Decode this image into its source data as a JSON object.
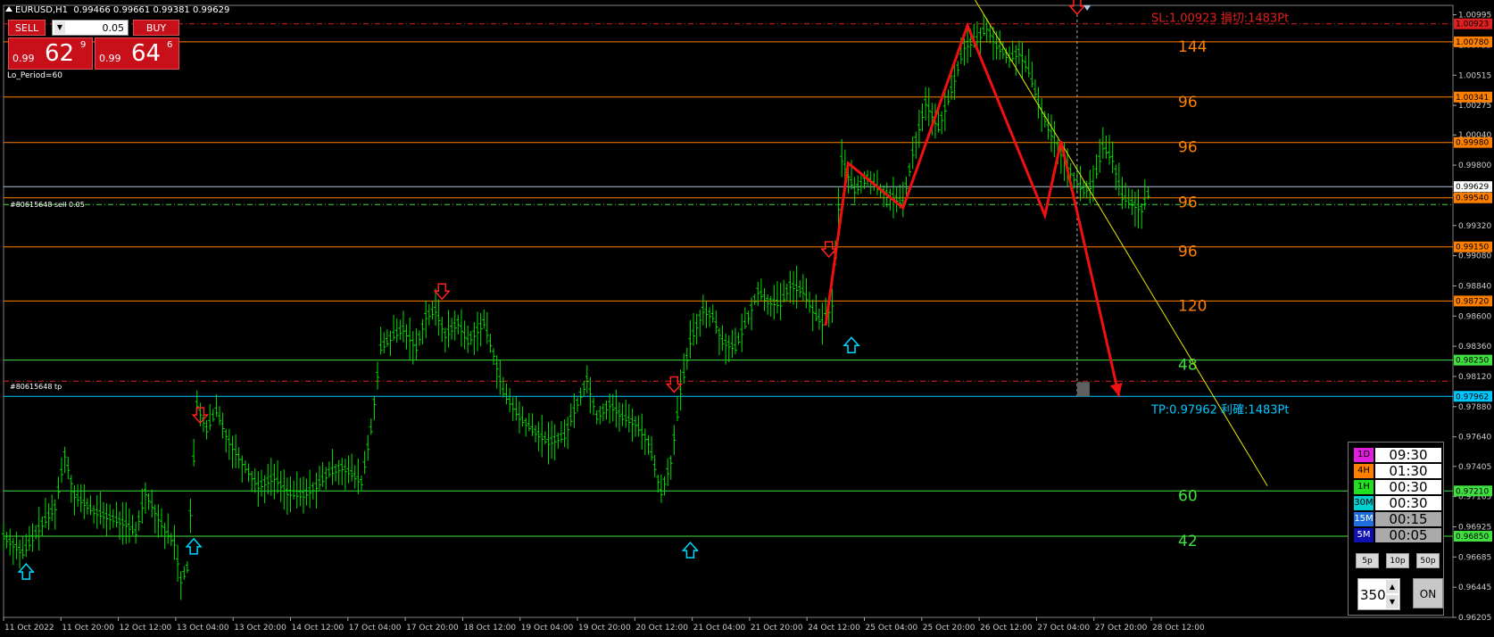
{
  "header": {
    "title": "EURUSD,H1",
    "ohlc": "0.99466 0.99661 0.99381 0.99629"
  },
  "trade_panel": {
    "sell_label": "SELL",
    "buy_label": "BUY",
    "lot": "0.05",
    "lot_arrow": "▼",
    "sell_small": "0.99",
    "sell_big": "62",
    "sell_sup": "9",
    "buy_small": "0.99",
    "buy_big": "64",
    "buy_sup": "6"
  },
  "indicator_label": "Lo_Period=60",
  "order_labels": {
    "sell": "#80615648 sell 0.05",
    "tp": "#80615648 tp"
  },
  "annotations": {
    "sl": "SL:1.00923 損切:1483Pt",
    "tp": "TP:0.97962 利確:1483Pt"
  },
  "timer_panel": {
    "rows": [
      {
        "tf": "1D",
        "time": "09:30",
        "color": "#e020e0"
      },
      {
        "tf": "4H",
        "time": "01:30",
        "color": "#ff7f00"
      },
      {
        "tf": "1H",
        "time": "00:30",
        "color": "#20e020"
      },
      {
        "tf": "30M",
        "time": "00:30",
        "color": "#00d0d0"
      },
      {
        "tf": "15M",
        "time": "00:15",
        "color": "#1e6ee0"
      },
      {
        "tf": "5M",
        "time": "00:05",
        "color": "#1010b0"
      }
    ],
    "buttons": [
      "5p",
      "10p",
      "50p"
    ],
    "spinner_value": "350",
    "spin_up": "▲",
    "spin_down": "▼",
    "on_label": "ON"
  },
  "chart_data": {
    "type": "line",
    "symbol": "EURUSD",
    "timeframe": "H1",
    "price_axis_ticks": [
      "1.00995",
      "1.00755",
      "1.00515",
      "1.00275",
      "1.00040",
      "0.99800",
      "0.99560",
      "0.99320",
      "0.99080",
      "0.98840",
      "0.98600",
      "0.98360",
      "0.98120",
      "0.97880",
      "0.97640",
      "0.97405",
      "0.97165",
      "0.96925",
      "0.96685",
      "0.96445",
      "0.96205"
    ],
    "time_axis_labels": [
      "11 Oct 2022",
      "11 Oct 20:00",
      "12 Oct 12:00",
      "13 Oct 04:00",
      "13 Oct 20:00",
      "14 Oct 12:00",
      "17 Oct 04:00",
      "17 Oct 20:00",
      "18 Oct 12:00",
      "19 Oct 04:00",
      "19 Oct 20:00",
      "20 Oct 12:00",
      "21 Oct 04:00",
      "21 Oct 20:00",
      "24 Oct 12:00",
      "25 Oct 04:00",
      "25 Oct 20:00",
      "26 Oct 12:00",
      "27 Oct 04:00",
      "27 Oct 20:00",
      "28 Oct 12:00"
    ],
    "ylim": [
      0.96205,
      1.0107
    ],
    "horizontal_levels": [
      {
        "price": 1.00923,
        "label": "1.00923",
        "color": "#e02020",
        "style": "dashdot"
      },
      {
        "price": 1.0078,
        "label": "1.00780",
        "color": "#ff7f00"
      },
      {
        "price": 1.00341,
        "label": "1.00341",
        "color": "#ff7f00"
      },
      {
        "price": 0.9998,
        "label": "0.99980",
        "color": "#ff7f00"
      },
      {
        "price": 0.99629,
        "label": "0.99629",
        "color": "#b0c4de",
        "style": "bid"
      },
      {
        "price": 0.9954,
        "label": "0.99540",
        "color": "#ff7f00"
      },
      {
        "price": 0.9915,
        "label": "0.99150",
        "color": "#ff7f00"
      },
      {
        "price": 0.9872,
        "label": "0.98720",
        "color": "#ff7f00"
      },
      {
        "price": 0.9825,
        "label": "0.98250",
        "color": "#40e040"
      },
      {
        "price": 0.97962,
        "label": "0.97962",
        "color": "#00c8ff",
        "style": "tp"
      },
      {
        "price": 0.9721,
        "label": "0.97210",
        "color": "#40e040"
      },
      {
        "price": 0.9685,
        "label": "0.96850",
        "color": "#40e040"
      }
    ],
    "level_counts": [
      {
        "price": 1.0078,
        "text": "144",
        "color": "#ff7f00"
      },
      {
        "price": 1.00341,
        "text": "96",
        "color": "#ff7f00"
      },
      {
        "price": 0.9998,
        "text": "96",
        "color": "#ff7f00"
      },
      {
        "price": 0.9954,
        "text": "96",
        "color": "#ff7f00"
      },
      {
        "price": 0.9915,
        "text": "96",
        "color": "#ff7f00"
      },
      {
        "price": 0.9872,
        "text": "120",
        "color": "#ff7f00"
      },
      {
        "price": 0.9825,
        "text": "48",
        "color": "#40e040"
      },
      {
        "price": 0.9721,
        "text": "60",
        "color": "#40e040"
      },
      {
        "price": 0.9685,
        "text": "42",
        "color": "#40e040"
      }
    ],
    "price_path": [
      [
        0,
        0.9685
      ],
      [
        6,
        0.9672
      ],
      [
        12,
        0.9695
      ],
      [
        16,
        0.9708
      ],
      [
        19,
        0.975
      ],
      [
        22,
        0.9718
      ],
      [
        28,
        0.9705
      ],
      [
        33,
        0.97
      ],
      [
        38,
        0.9695
      ],
      [
        41,
        0.9688
      ],
      [
        44,
        0.972
      ],
      [
        47,
        0.9705
      ],
      [
        50,
        0.969
      ],
      [
        53,
        0.968
      ],
      [
        55,
        0.965
      ],
      [
        57,
        0.966
      ],
      [
        60,
        0.979
      ],
      [
        63,
        0.977
      ],
      [
        66,
        0.9785
      ],
      [
        70,
        0.976
      ],
      [
        75,
        0.974
      ],
      [
        79,
        0.9725
      ],
      [
        84,
        0.9732
      ],
      [
        88,
        0.972
      ],
      [
        93,
        0.9718
      ],
      [
        97,
        0.9725
      ],
      [
        101,
        0.9736
      ],
      [
        105,
        0.974
      ],
      [
        108,
        0.9735
      ],
      [
        111,
        0.9728
      ],
      [
        114,
        0.977
      ],
      [
        117,
        0.9835
      ],
      [
        121,
        0.9845
      ],
      [
        124,
        0.985
      ],
      [
        128,
        0.9835
      ],
      [
        131,
        0.986
      ],
      [
        134,
        0.9865
      ],
      [
        137,
        0.9845
      ],
      [
        141,
        0.9855
      ],
      [
        144,
        0.984
      ],
      [
        149,
        0.9855
      ],
      [
        152,
        0.983
      ],
      [
        155,
        0.98
      ],
      [
        160,
        0.978
      ],
      [
        164,
        0.977
      ],
      [
        169,
        0.976
      ],
      [
        174,
        0.9765
      ],
      [
        177,
        0.9785
      ],
      [
        181,
        0.981
      ],
      [
        184,
        0.978
      ],
      [
        188,
        0.979
      ],
      [
        192,
        0.978
      ],
      [
        196,
        0.9775
      ],
      [
        200,
        0.976
      ],
      [
        204,
        0.972
      ],
      [
        207,
        0.9745
      ],
      [
        210,
        0.98
      ],
      [
        213,
        0.984
      ],
      [
        217,
        0.9865
      ],
      [
        220,
        0.986
      ],
      [
        223,
        0.984
      ],
      [
        227,
        0.9835
      ],
      [
        231,
        0.986
      ],
      [
        234,
        0.988
      ],
      [
        237,
        0.9872
      ],
      [
        241,
        0.987
      ],
      [
        244,
        0.9885
      ],
      [
        248,
        0.988
      ],
      [
        252,
        0.986
      ],
      [
        254,
        0.9855
      ],
      [
        257,
        0.987
      ],
      [
        260,
        0.9985
      ],
      [
        264,
        0.996
      ],
      [
        268,
        0.997
      ],
      [
        272,
        0.996
      ],
      [
        276,
        0.9955
      ],
      [
        279,
        0.995
      ],
      [
        282,
        0.999
      ],
      [
        286,
        1.003
      ],
      [
        290,
        1.001
      ],
      [
        294,
        1.004
      ],
      [
        298,
        1.0075
      ],
      [
        302,
        1.008
      ],
      [
        305,
        1.009
      ],
      [
        308,
        1.0075
      ],
      [
        312,
        1.0065
      ],
      [
        315,
        1.007
      ],
      [
        318,
        1.0055
      ],
      [
        321,
        1.003
      ],
      [
        324,
        1.001
      ],
      [
        328,
        0.999
      ],
      [
        332,
        0.997
      ],
      [
        335,
        0.996
      ],
      [
        338,
        0.9965
      ],
      [
        341,
        0.9995
      ],
      [
        344,
        0.9985
      ],
      [
        347,
        0.9955
      ],
      [
        350,
        0.995
      ],
      [
        353,
        0.9945
      ],
      [
        356,
        0.9963
      ]
    ],
    "total_bars": 356,
    "zigzag": [
      [
        255,
        0.98525
      ],
      [
        262,
        0.99815
      ],
      [
        279,
        0.9946
      ],
      [
        299,
        1.0091
      ],
      [
        323,
        0.994
      ],
      [
        328,
        0.9999
      ],
      [
        346,
        0.97962
      ]
    ],
    "down_arrows": [
      [
        61,
        0.978
      ],
      [
        136,
        0.98785
      ],
      [
        208,
        0.98045
      ],
      [
        256,
        0.9912
      ],
      [
        333,
        1.0105
      ]
    ],
    "up_arrows": [
      [
        7,
        0.9658
      ],
      [
        59,
        0.9678
      ],
      [
        213,
        0.9675
      ],
      [
        263,
        0.9838
      ]
    ],
    "trendline": [
      [
        300,
        1.0117
      ],
      [
        392,
        0.9725
      ]
    ],
    "vline_bar": 333
  }
}
